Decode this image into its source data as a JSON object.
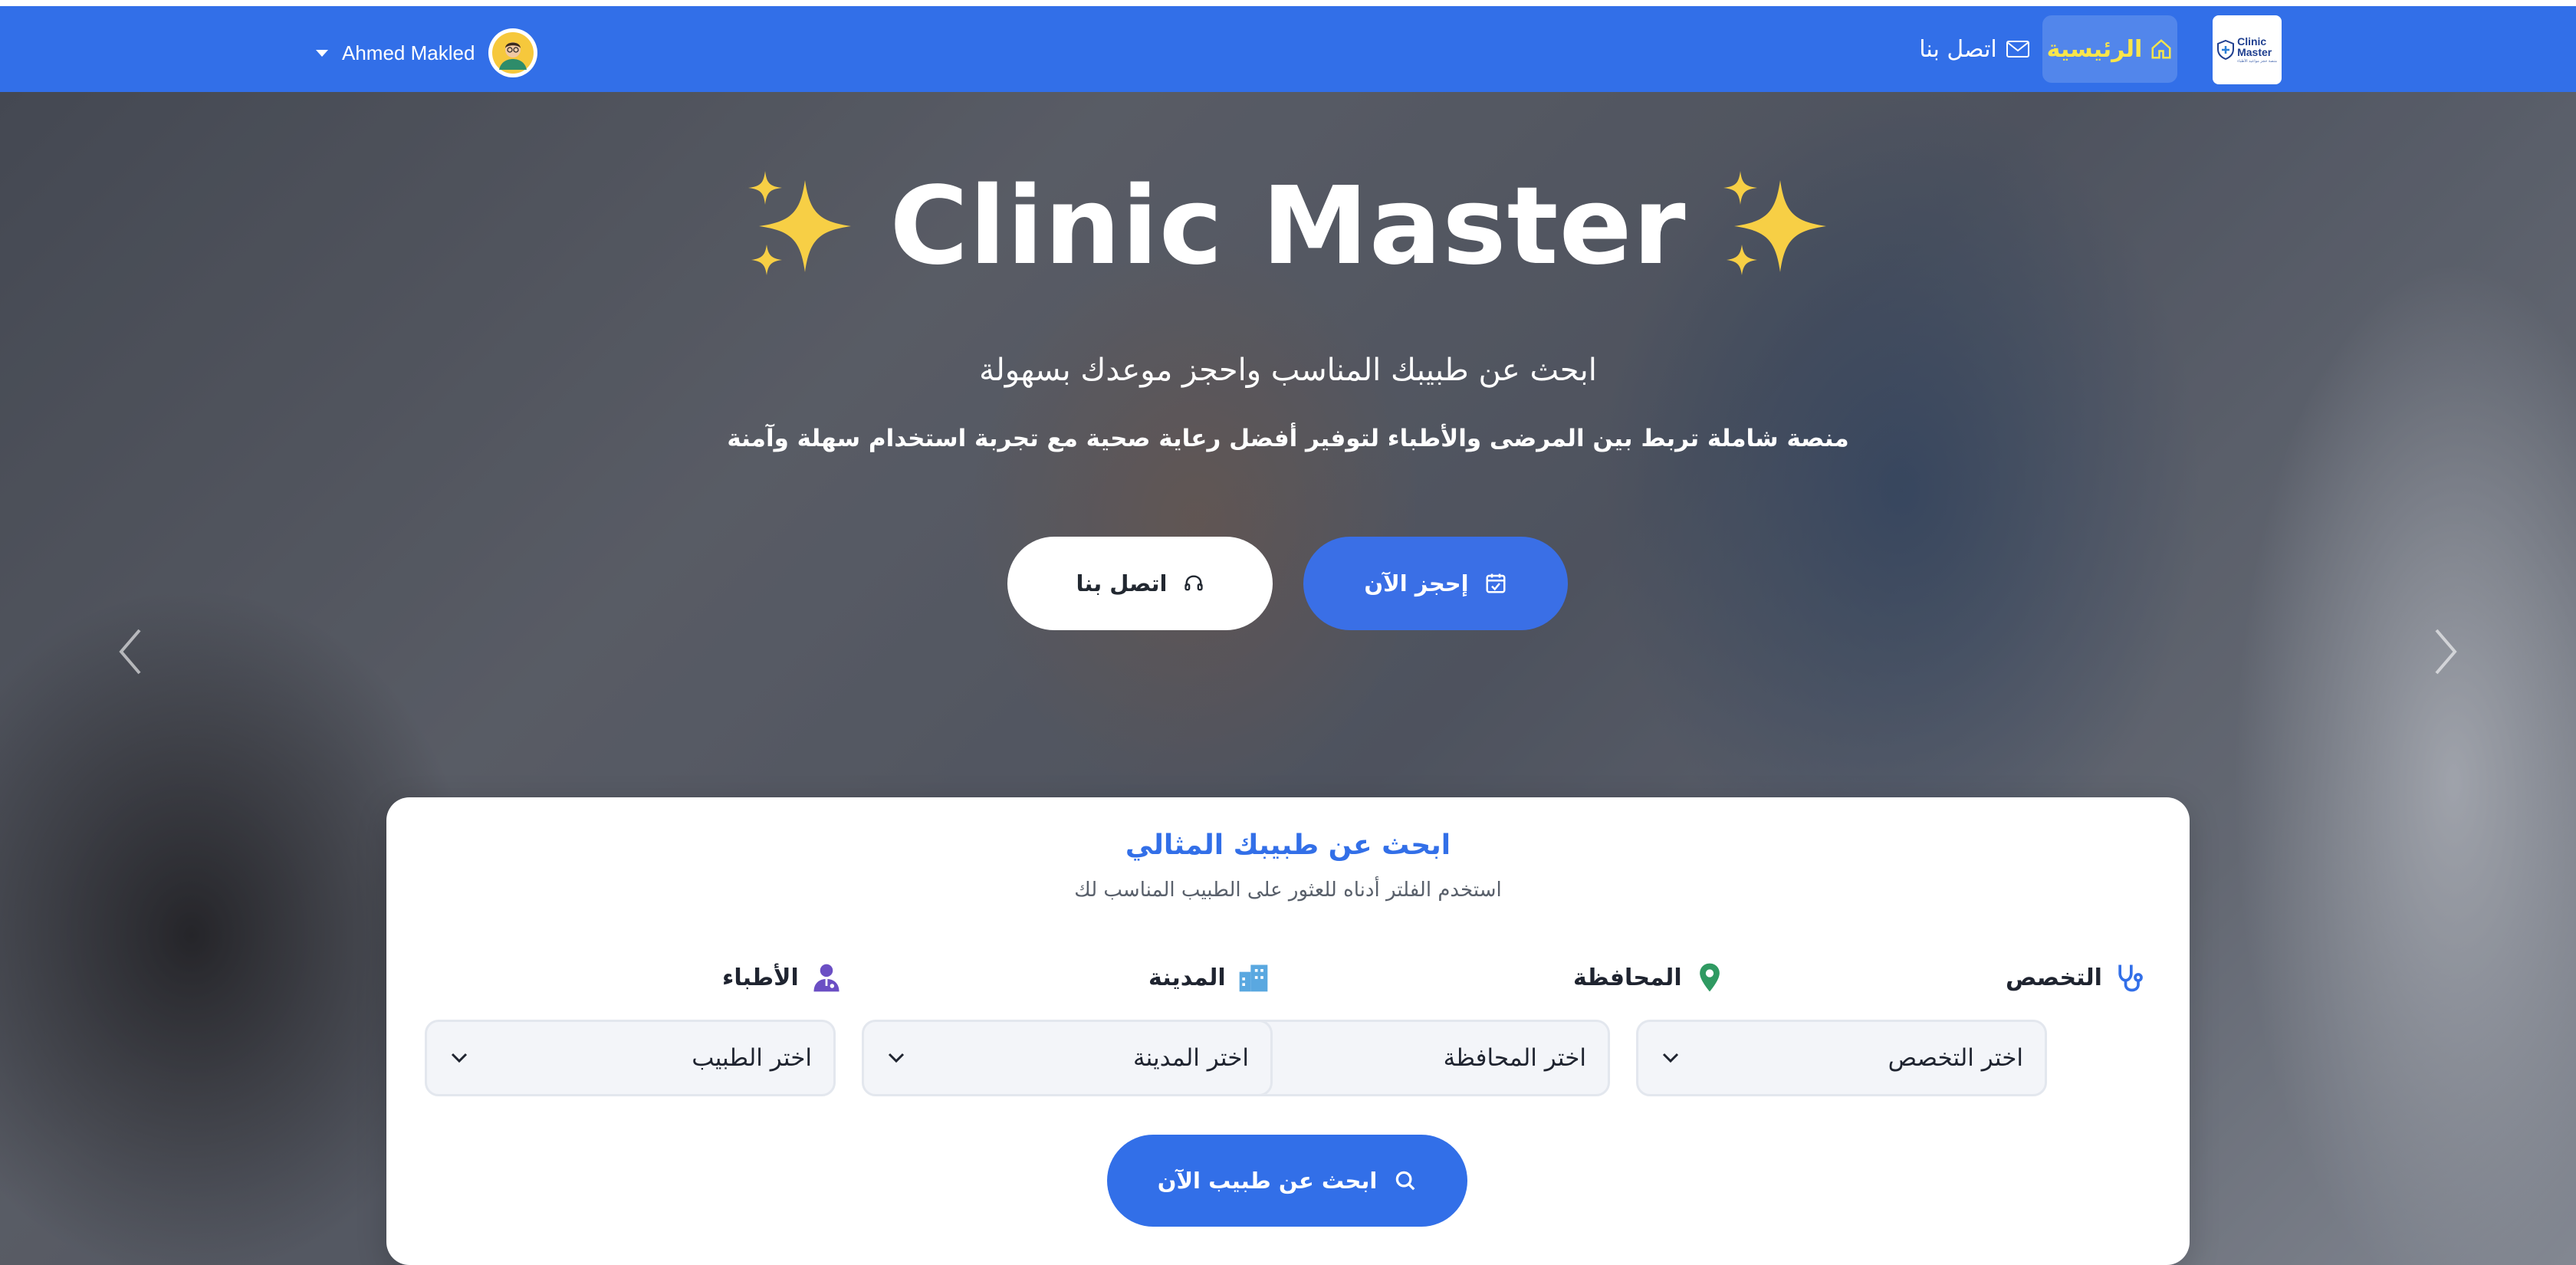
{
  "colors": {
    "primary": "#326fe8",
    "home_highlight": "#f9e54a",
    "card_bg": "#ffffff",
    "text_dark": "#1f2430"
  },
  "navbar": {
    "logo": {
      "line1": "Clinic",
      "line2": "Master",
      "tagline": "منصة حجز مواعيد الأطباء"
    },
    "home_label": "الرئيسية",
    "home_icon": "home-icon",
    "contact_label": "اتصل بنا",
    "contact_icon": "mail-icon",
    "user": {
      "name": "Ahmed Makled",
      "avatar_icon": "user-avatar-icon",
      "menu_icon": "caret-down-icon"
    }
  },
  "hero": {
    "title": "Clinic Master",
    "title_decoration_icon": "sparkles-icon",
    "subtitle": "ابحث عن طبيبك المناسب واحجز موعدك بسهولة",
    "description": "منصة شاملة تربط بين المرضى والأطباء لتوفير أفضل رعاية صحية مع تجربة استخدام سهلة وآمنة",
    "book_button": "إحجز الآن",
    "book_icon": "calendar-check-icon",
    "contact_button": "اتصل بنا",
    "contact_icon": "headset-icon",
    "carousel": {
      "slides": 3,
      "active_slide": 3
    }
  },
  "search": {
    "title": "ابحث عن طبيبك المثالي",
    "subtitle": "استخدم الفلتر أدناه للعثور على الطبيب المناسب لك",
    "fields": {
      "specialty": {
        "label": "التخصص",
        "placeholder": "اختر التخصص",
        "icon": "stethoscope-icon"
      },
      "governorate": {
        "label": "المحافظة",
        "placeholder": "اختر المحافظة",
        "icon": "map-pin-icon"
      },
      "city": {
        "label": "المدينة",
        "placeholder": "اختر المدينة",
        "icon": "city-icon"
      },
      "doctor": {
        "label": "الأطباء",
        "placeholder": "اختر الطبيب",
        "icon": "doctor-icon"
      }
    },
    "submit_label": "ابحث عن طبيب الآن",
    "submit_icon": "search-icon"
  }
}
